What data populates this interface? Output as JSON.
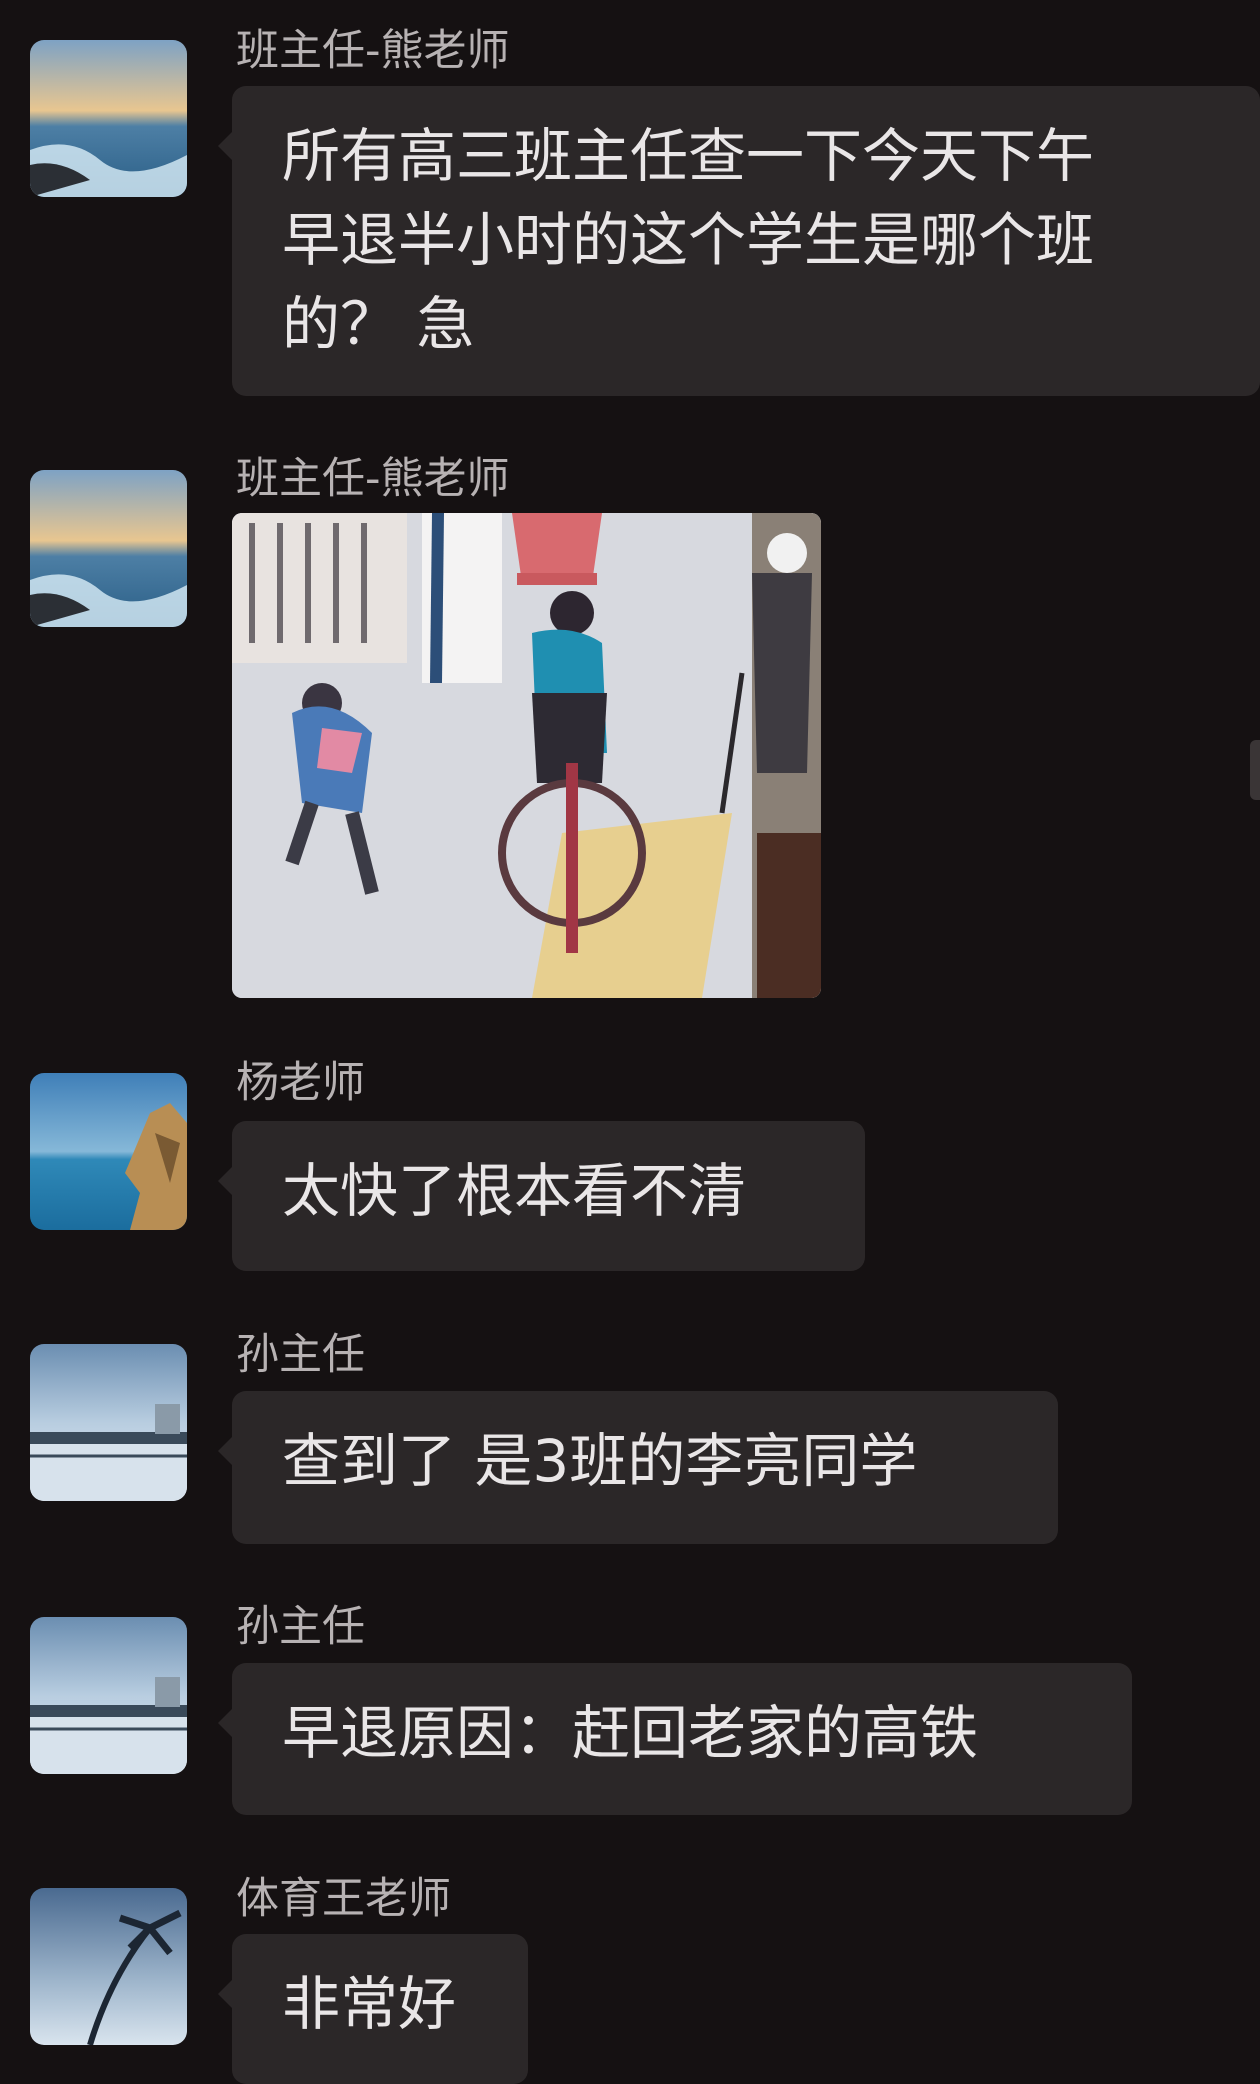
{
  "messages": [
    {
      "sender": "班主任-熊老师",
      "lines": [
        "所有高三班主任查一下今天下午",
        "早退半小时的这个学生是哪个班",
        "的？ 急"
      ]
    },
    {
      "sender": "班主任-熊老师",
      "image_icon": "cctv-snapshot-image"
    },
    {
      "sender": "杨老师",
      "lines": [
        "太快了根本看不清"
      ]
    },
    {
      "sender": "孙主任",
      "lines": [
        "查到了 是3班的李亮同学"
      ]
    },
    {
      "sender": "孙主任",
      "lines": [
        "早退原因：赶回老家的高铁"
      ]
    },
    {
      "sender": "体育王老师",
      "lines": [
        "非常好"
      ]
    }
  ],
  "colors": {
    "background": "#151112",
    "bubble": "#2b2728",
    "sender_text": "#b7b2b3",
    "message_text": "#e9e6e7"
  }
}
